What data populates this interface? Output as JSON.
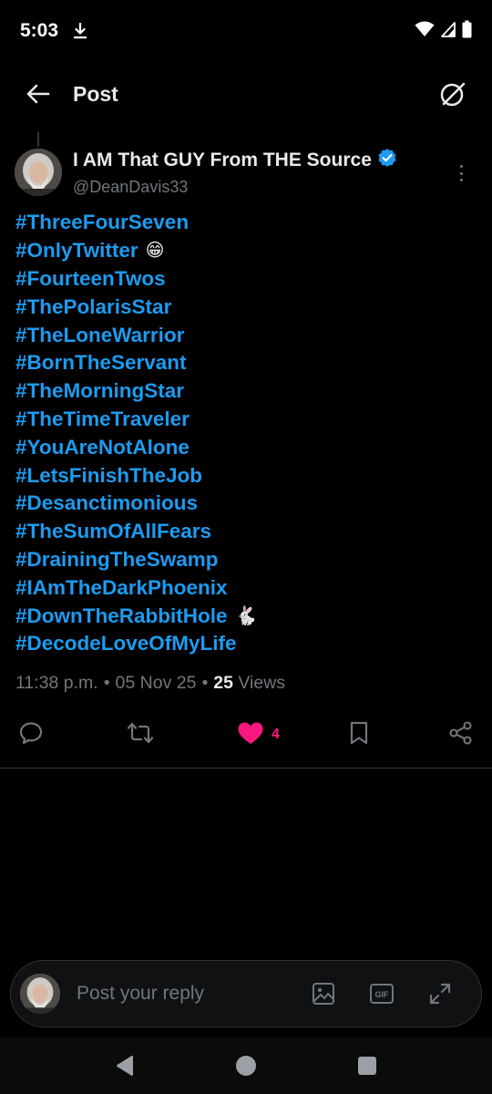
{
  "status_bar": {
    "time": "5:03"
  },
  "header": {
    "title": "Post"
  },
  "author": {
    "name": "I AM That GUY From THE Source",
    "handle": "@DeanDavis33",
    "verified": true
  },
  "post": {
    "lines": [
      {
        "tag": "#ThreeFourSeven",
        "emoji": ""
      },
      {
        "tag": "#OnlyTwitter",
        "emoji": "😁"
      },
      {
        "tag": "#FourteenTwos",
        "emoji": ""
      },
      {
        "tag": "#ThePolarisStar",
        "emoji": ""
      },
      {
        "tag": "#TheLoneWarrior",
        "emoji": ""
      },
      {
        "tag": "#BornTheServant",
        "emoji": ""
      },
      {
        "tag": "#TheMorningStar",
        "emoji": ""
      },
      {
        "tag": "#TheTimeTraveler",
        "emoji": ""
      },
      {
        "tag": "#YouAreNotAlone",
        "emoji": ""
      },
      {
        "tag": "#LetsFinishTheJob",
        "emoji": ""
      },
      {
        "tag": "#Desanctimonious",
        "emoji": ""
      },
      {
        "tag": "#TheSumOfAllFears",
        "emoji": ""
      },
      {
        "tag": "#DrainingTheSwamp",
        "emoji": ""
      },
      {
        "tag": "#IAmTheDarkPhoenix",
        "emoji": ""
      },
      {
        "tag": "#DownTheRabbitHole",
        "emoji": "🐇"
      },
      {
        "tag": "#DecodeLoveOfMyLife",
        "emoji": ""
      }
    ],
    "time": "11:38 p.m.",
    "date": "05 Nov 25",
    "views_count": "25",
    "views_label": "Views"
  },
  "actions": {
    "like_count": "4",
    "liked": true
  },
  "reply": {
    "placeholder": "Post your reply"
  },
  "colors": {
    "accent": "#1d9bf0",
    "like": "#f91880",
    "muted": "#71767b",
    "background": "#000000"
  },
  "icons": [
    "download-icon",
    "wifi-icon",
    "signal-icon",
    "battery-icon",
    "back-arrow-icon",
    "grok-icon",
    "verified-badge-icon",
    "more-icon",
    "reply-icon",
    "repost-icon",
    "heart-icon",
    "bookmark-icon",
    "share-icon",
    "image-icon",
    "gif-icon",
    "expand-icon",
    "nav-back-icon",
    "nav-home-icon",
    "nav-recents-icon"
  ]
}
